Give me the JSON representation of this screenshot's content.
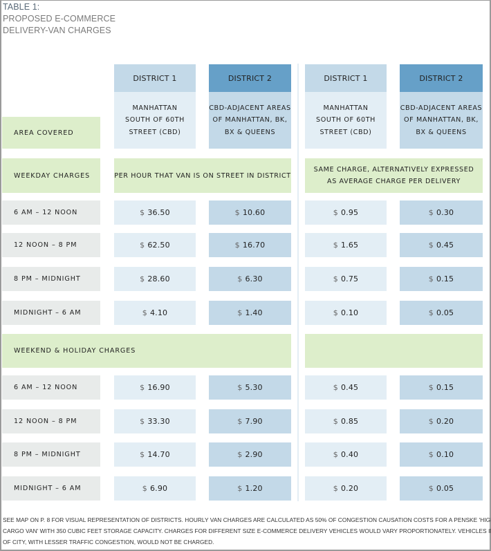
{
  "title": {
    "line1": "TABLE 1:",
    "line2": "PROPOSED E-COMMERCE",
    "line3": "DELIVERY-VAN CHARGES"
  },
  "colors": {
    "district1_header": "#c3d9e8",
    "district2_header": "#66a0c8",
    "district1_cell": "#e3eef5",
    "district2_cell": "#c3d9e8",
    "section_green": "#ddeecb",
    "row_label_gray": "#e8ebea"
  },
  "columns": [
    {
      "header": "DISTRICT 1",
      "area": [
        "MANHATTAN",
        "SOUTH OF 60TH",
        "STREET (CBD)"
      ]
    },
    {
      "header": "DISTRICT 2",
      "area": [
        "CBD-ADJACENT AREAS",
        "OF MANHATTAN, BK,",
        "BX & QUEENS"
      ]
    },
    {
      "header": "DISTRICT 1",
      "area": [
        "MANHATTAN",
        "SOUTH OF 60TH",
        "STREET (CBD)"
      ]
    },
    {
      "header": "DISTRICT 2",
      "area": [
        "CBD-ADJACENT AREAS",
        "OF MANHATTAN, BK,",
        "BX & QUEENS"
      ]
    }
  ],
  "area_covered_label": "AREA COVERED",
  "weekday": {
    "label": "WEEKDAY CHARGES",
    "left_note": "PER HOUR THAT VAN IS ON STREET IN DISTRICT",
    "right_note": [
      "SAME CHARGE, ALTERNATIVELY EXPRESSED",
      "AS AVERAGE CHARGE PER DELIVERY"
    ],
    "rows": [
      {
        "period": "6 AM – 12 NOON",
        "currency": "$",
        "values": [
          "36.50",
          "10.60",
          "0.95",
          "0.30"
        ]
      },
      {
        "period": "12 NOON – 8 PM",
        "currency": "$",
        "values": [
          "62.50",
          "16.70",
          "1.65",
          "0.45"
        ]
      },
      {
        "period": "8 PM – MIDNIGHT",
        "currency": "$",
        "values": [
          "28.60",
          "6.30",
          "0.75",
          "0.15"
        ]
      },
      {
        "period": "MIDNIGHT – 6 AM",
        "currency": "$",
        "values": [
          "4.10",
          "1.40",
          "0.10",
          "0.05"
        ]
      }
    ]
  },
  "weekend": {
    "label": "WEEKEND & HOLIDAY CHARGES",
    "rows": [
      {
        "period": "6 AM – 12 NOON",
        "currency": "$",
        "values": [
          "16.90",
          "5.30",
          "0.45",
          "0.15"
        ]
      },
      {
        "period": "12 NOON – 8 PM",
        "currency": "$",
        "values": [
          "33.30",
          "7.90",
          "0.85",
          "0.20"
        ]
      },
      {
        "period": "8 PM – MIDNIGHT",
        "currency": "$",
        "values": [
          "14.70",
          "2.90",
          "0.40",
          "0.10"
        ]
      },
      {
        "period": "MIDNIGHT – 6 AM",
        "currency": "$",
        "values": [
          "6.90",
          "1.20",
          "0.20",
          "0.05"
        ]
      }
    ]
  },
  "footer": {
    "line1": "SEE MAP ON P. 8 FOR VISUAL REPRESENTATION OF DISTRICTS. HOURLY VAN CHARGES ARE CALCULATED AS 50% OF CONGESTION CAUSATION COSTS FOR A PENSKE 'HIGH-ROOF",
    "line2": "CARGO VAN' WITH 350 CUBIC FEET STORAGE CAPACITY. CHARGES FOR DIFFERENT SIZE E-COMMERCE DELIVERY VEHICLES WOULD VARY PROPORTIONATELY. VEHICLES IN REST",
    "line3": "OF CITY, WITH LESSER TRAFFIC CONGESTION, WOULD NOT BE CHARGED."
  }
}
